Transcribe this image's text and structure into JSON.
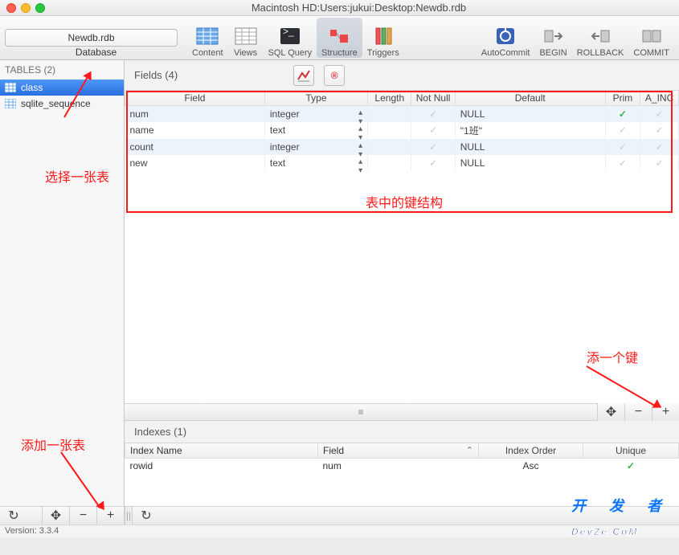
{
  "window": {
    "title": "Macintosh HD:Users:jukui:Desktop:Newdb.rdb"
  },
  "toolbar": {
    "database": {
      "dropdown": "Newdb.rdb",
      "label": "Database"
    },
    "content": "Content",
    "views": "Views",
    "sqlquery": "SQL Query",
    "structure": "Structure",
    "triggers": "Triggers",
    "autocommit": "AutoCommit",
    "begin": "BEGIN",
    "rollback": "ROLLBACK",
    "commit": "COMMIT"
  },
  "sidebar": {
    "heading": "TABLES (2)",
    "items": [
      {
        "name": "class"
      },
      {
        "name": "sqlite_sequence"
      }
    ]
  },
  "fields_panel": {
    "heading": "Fields (4)",
    "columns": {
      "field": "Field",
      "type": "Type",
      "length": "Length",
      "notnull": "Not Null",
      "default": "Default",
      "prim": "Prim",
      "ainc": "A_INC"
    },
    "rows": [
      {
        "field": "num",
        "type": "integer",
        "length": "",
        "notnull": false,
        "default": "NULL",
        "prim": true,
        "ainc": false
      },
      {
        "field": "name",
        "type": "text",
        "length": "",
        "notnull": false,
        "default": "\"1班\"",
        "prim": false,
        "ainc": false
      },
      {
        "field": "count",
        "type": "integer",
        "length": "",
        "notnull": false,
        "default": "NULL",
        "prim": false,
        "ainc": false
      },
      {
        "field": "new",
        "type": "text",
        "length": "",
        "notnull": false,
        "default": "NULL",
        "prim": false,
        "ainc": false
      }
    ]
  },
  "indexes_panel": {
    "heading": "Indexes (1)",
    "columns": {
      "name": "Index Name",
      "field": "Field",
      "order": "Index Order",
      "unique": "Unique"
    },
    "rows": [
      {
        "name": "rowid",
        "field": "num",
        "order": "Asc",
        "unique": true
      }
    ]
  },
  "footer": {
    "version_label": "Version: 3.3.4"
  },
  "annotations": {
    "select_table": "选择一张表",
    "field_structure": "表中的键结构",
    "add_field": "添一个键",
    "add_table": "添加一张表"
  },
  "watermark": {
    "top": "开 发 者",
    "bottom": "DevZe.CoM"
  },
  "glyphs": {
    "plus": "+",
    "minus": "−",
    "move": "✥",
    "refresh": "↻",
    "grip": "≡",
    "splitter": "||",
    "chev": "⌃"
  }
}
